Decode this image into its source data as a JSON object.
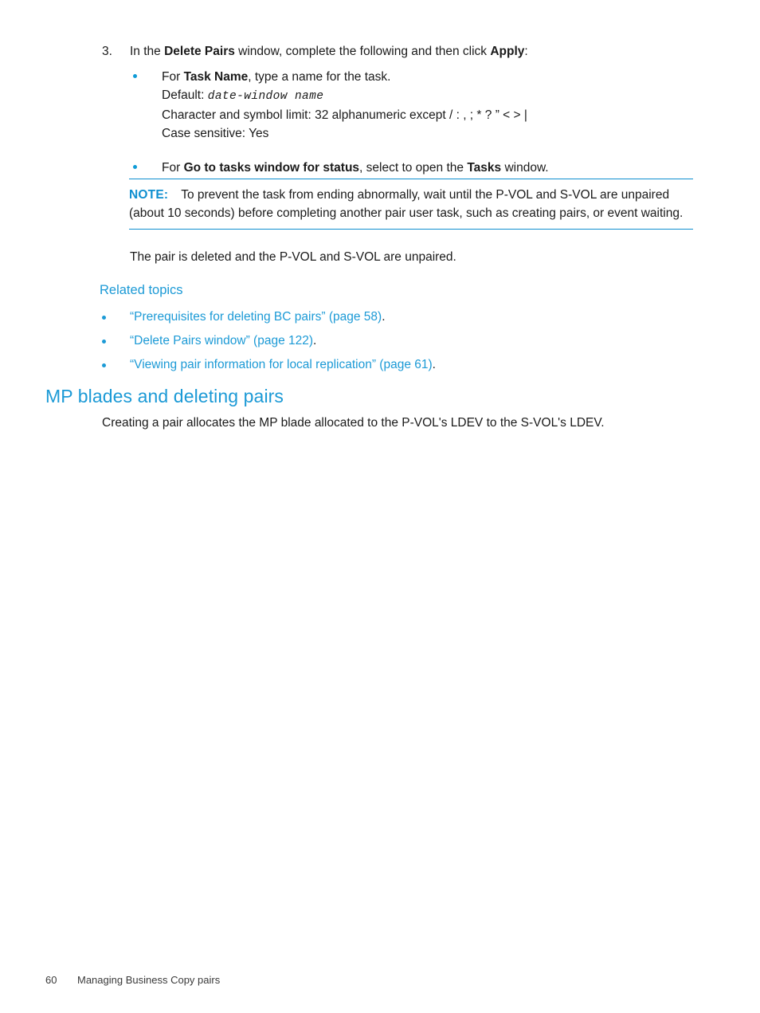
{
  "page": {
    "number": "60",
    "footer_title": "Managing Business Copy pairs"
  },
  "colors": {
    "link": "#1c9ad6",
    "heading": "#1c9ad6",
    "note_rule": "#0f8fd0",
    "bullet": "#0f9bd7",
    "text": "#1a1a1a"
  },
  "step": {
    "number": "3.",
    "text_1": "In the ",
    "bold_1": "Delete Pairs",
    "text_2": " window, complete the following and then click ",
    "bold_2": "Apply",
    "text_3": ":"
  },
  "bullets": [
    {
      "text_1": "For ",
      "bold_1": "Task Name",
      "text_2": ", type a name for the task."
    },
    {
      "text_1": "For ",
      "bold_1": "Go to tasks window for status",
      "text_2": ", select to open the ",
      "bold_2": "Tasks",
      "text_3": " window."
    }
  ],
  "task_name_details": {
    "default_label": "Default: ",
    "default_value": "date-window name",
    "char_limit": "Character and symbol limit: 32 alphanumeric except / : , ; * ? ” < > |",
    "case_sensitive": "Case sensitive: Yes"
  },
  "note": {
    "label": "NOTE:",
    "body": "To prevent the task from ending abnormally, wait until the P-VOL and S-VOL are unpaired (about 10 seconds) before completing another pair user task, such as creating pairs, or event waiting."
  },
  "after_note": "The pair is deleted and the P-VOL and S-VOL are unpaired.",
  "related_topics": {
    "title": "Related topics",
    "items": [
      {
        "link": "“Prerequisites for deleting BC pairs” (page 58)",
        "end": "."
      },
      {
        "link": "“Delete Pairs window” (page 122)",
        "end": "."
      },
      {
        "link": "“Viewing pair information for local replication” (page 61)",
        "end": "."
      }
    ]
  },
  "section": {
    "heading": "MP blades and deleting pairs",
    "body": "Creating a pair allocates the MP blade allocated to the P-VOL's LDEV to the S-VOL's LDEV."
  }
}
